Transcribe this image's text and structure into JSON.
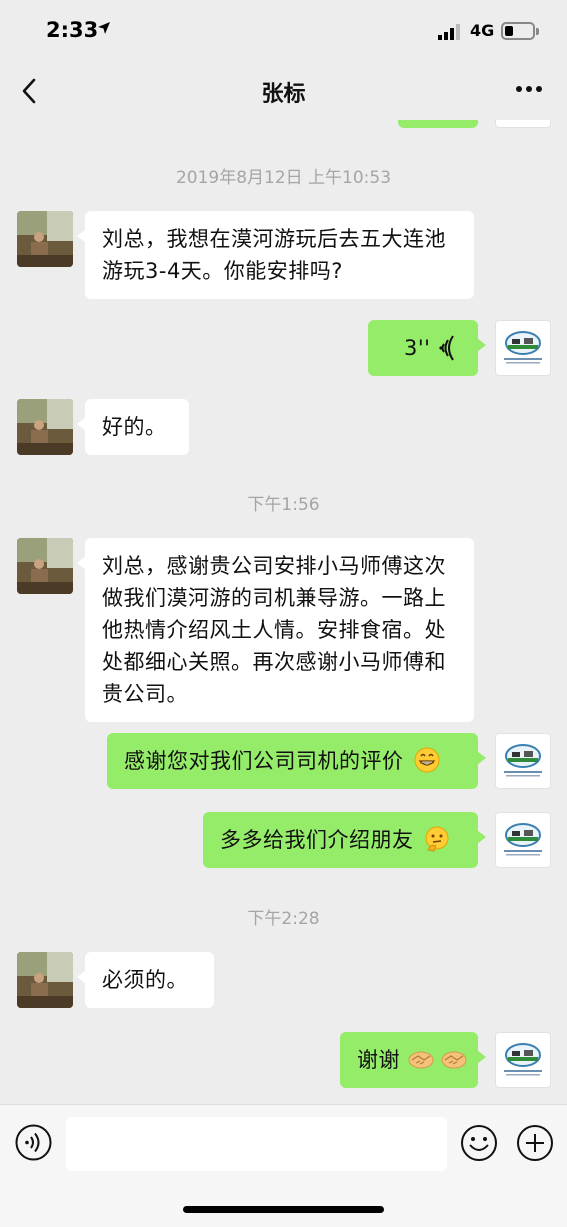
{
  "status": {
    "time": "2:33",
    "network": "4G"
  },
  "nav": {
    "title": "张标"
  },
  "messages": [
    {
      "type": "timestamp",
      "text": "2019年8月12日 上午10:53"
    },
    {
      "type": "text",
      "from": "them",
      "text": "刘总，我想在漠河游玩后去五大连池游玩3-4天。你能安排吗?"
    },
    {
      "type": "voice",
      "from": "me",
      "duration": "3''"
    },
    {
      "type": "text",
      "from": "them",
      "text": "好的。"
    },
    {
      "type": "timestamp",
      "text": "下午1:56"
    },
    {
      "type": "text",
      "from": "them",
      "text": "刘总，感谢贵公司安排小马师傅这次做我们漠河游的司机兼导游。一路上他热情介绍风土人情。安排食宿。处处都细心关照。再次感谢小马师傅和贵公司。"
    },
    {
      "type": "text",
      "from": "me",
      "text": "感谢您对我们公司司机的评价",
      "emoji": "grin-emoji"
    },
    {
      "type": "text",
      "from": "me",
      "text": "多多给我们介绍朋友",
      "emoji": "thinking-emoji"
    },
    {
      "type": "timestamp",
      "text": "下午2:28"
    },
    {
      "type": "text",
      "from": "them",
      "text": "必须的。"
    },
    {
      "type": "text",
      "from": "me",
      "text": "谢谢",
      "emoji": "handshake-emoji"
    }
  ],
  "input": {
    "value": "",
    "placeholder": ""
  },
  "colors": {
    "background": "#ededed",
    "my_bubble": "#95ec69",
    "their_bubble": "#ffffff",
    "timestamp_text": "#a5a5a5"
  }
}
